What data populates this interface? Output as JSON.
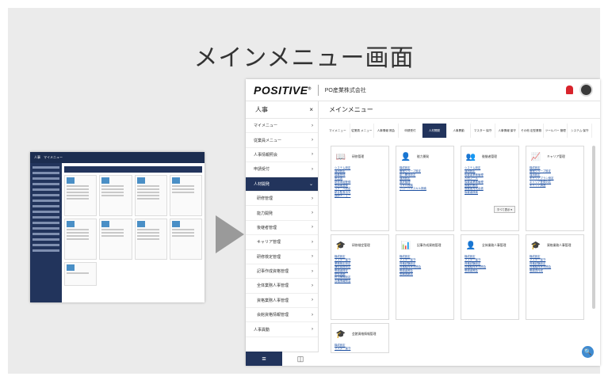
{
  "slide": {
    "title": "メインメニュー画面"
  },
  "window": {
    "logo": "POSITIVE",
    "logo_mark": "®",
    "company": "PO産業株式会社",
    "bell_icon": "bell-icon",
    "avatar_icon": "user-avatar"
  },
  "sidebar": {
    "header": "人事",
    "close": "×",
    "items": [
      {
        "label": "マイメニュー",
        "chevron": "›"
      },
      {
        "label": "従業員メニュー",
        "chevron": "›"
      },
      {
        "label": "人事情報照会",
        "chevron": "›"
      },
      {
        "label": "申請受付",
        "chevron": "›"
      },
      {
        "label": "人材開発",
        "chevron": "⌄",
        "active": true
      },
      {
        "label": "研修管理",
        "chevron": "›",
        "sub": true
      },
      {
        "label": "能力開発",
        "chevron": "›",
        "sub": true
      },
      {
        "label": "後継者管理",
        "chevron": "›",
        "sub": true
      },
      {
        "label": "キャリア管理",
        "chevron": "›",
        "sub": true
      },
      {
        "label": "研修検定管理",
        "chevron": "›",
        "sub": true
      },
      {
        "label": "記事作成資格管理",
        "chevron": "›",
        "sub": true
      },
      {
        "label": "全体業務人事管理",
        "chevron": "›",
        "sub": true
      },
      {
        "label": "資格業務人事管理",
        "chevron": "›",
        "sub": true
      },
      {
        "label": "会館資格情報管理",
        "chevron": "›",
        "sub": true
      },
      {
        "label": "人事異動",
        "chevron": "›"
      }
    ],
    "footer_menu": "≡",
    "footer_icon": "◫"
  },
  "content": {
    "title": "メインメニュー",
    "tabs": [
      {
        "label": "マイメニュー"
      },
      {
        "label": "従業員 メニュー"
      },
      {
        "label": "人事情報 照会"
      },
      {
        "label": "申請受付"
      },
      {
        "label": "人材開発",
        "active": true
      },
      {
        "label": "人事異動"
      },
      {
        "label": "マスター 保守"
      },
      {
        "label": "人事情報 保守"
      },
      {
        "label": "その他 定型業務"
      },
      {
        "label": "ツールバー 管理"
      },
      {
        "label": "システム 保守"
      }
    ],
    "cards": [
      {
        "title": "研修管理",
        "icon": "📖",
        "color": "#2f6fb8",
        "links": [
          "システム設定",
          "運用設定",
          "講義登録",
          "申込書",
          "研修承認登録",
          "受講者登録",
          "スケール設定",
          "統合監査出欠",
          "講師メニュー"
        ]
      },
      {
        "title": "能力開発",
        "icon": "👤",
        "color": "#1f4f8f",
        "links": [
          "構成設定",
          "管理グループ設定",
          "能力開発設定",
          "運用設定",
          "選択管理",
          "スキル検索",
          "グローバルスキル検索"
        ]
      },
      {
        "title": "後継者管理",
        "icon": "👥",
        "color": "#1f4f8f",
        "links": [
          "システム設定",
          "運用設定",
          "後継者業務管理",
          "人材プール",
          "後継者業務管理",
          "後継計画書",
          "後継者育成出張",
          "後継者検索"
        ],
        "more": "すべて表示 ▾"
      },
      {
        "title": "キャリア管理",
        "icon": "📈",
        "color": "#1a8c8c",
        "links": [
          "構成設定",
          "管理グループ設定",
          "運用設定",
          "キャリアプラン設定",
          "キャリア登録対応",
          "キャリア調査"
        ]
      },
      {
        "title": "研修検定管理",
        "icon": "🎓",
        "color": "#1f4f8f",
        "links": [
          "構成設定",
          "マスター保守",
          "業務検定設定",
          "通信講座設定",
          "受講者検定",
          "研修実績",
          "担当業務設定",
          "合格情報照会"
        ]
      },
      {
        "title": "記事作成資格管理",
        "icon": "📊",
        "color": "#2a9a5a",
        "links": [
          "構成設定",
          "マスター保守",
          "資格試験設定",
          "資格取得状況照会",
          "受講者照会",
          "受験実績書"
        ]
      },
      {
        "title": "全体業務人事管理",
        "icon": "👤",
        "color": "#e0a020",
        "links": [
          "構成設定",
          "マスター保守",
          "資格試験設定",
          "資格取得状況照会",
          "受講者照会"
        ]
      },
      {
        "title": "資格業務人事管理",
        "icon": "🎓",
        "color": "#2a9a5a",
        "links": [
          "構成設定",
          "マスター保守",
          "資格試験設定",
          "資格取得状況照会",
          "受講書作成"
        ]
      },
      {
        "title": "会館資格情報管理",
        "icon": "🎓",
        "color": "#2a9a5a",
        "links": [
          "構成設定",
          "マスター保守"
        ]
      }
    ],
    "zoom_icon": "🔍"
  },
  "thumbnail": {
    "header": "人事　マイメニュー"
  }
}
